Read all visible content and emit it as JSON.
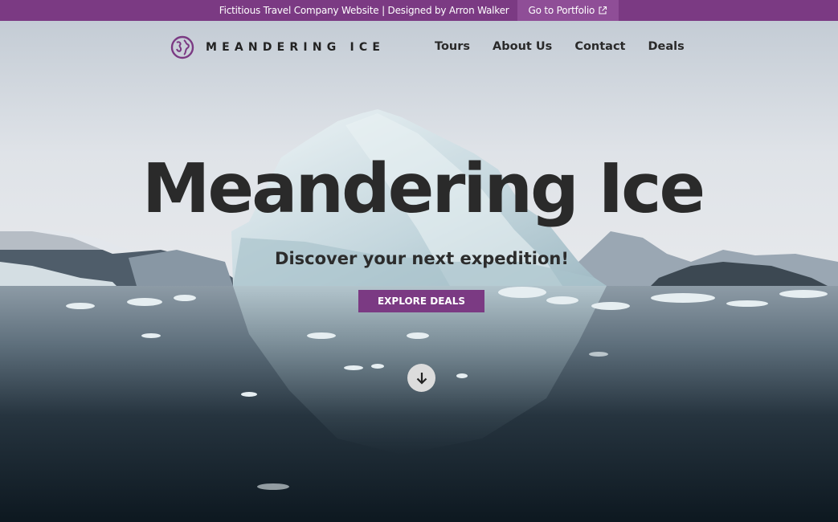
{
  "banner": {
    "text": "Fictitious Travel Company Website | Designed by Arron Walker",
    "portfolio_label": "Go to Portfolio"
  },
  "brand": {
    "name": "MEANDERING ICE",
    "accent_color": "#7b3a83"
  },
  "nav": {
    "items": [
      {
        "label": "Tours"
      },
      {
        "label": "About Us"
      },
      {
        "label": "Contact"
      },
      {
        "label": "Deals"
      }
    ]
  },
  "hero": {
    "title": "Meandering Ice",
    "subtitle": "Discover your next expedition!",
    "cta_label": "EXPLORE DEALS",
    "scroll_icon": "arrow-down-icon"
  },
  "icons": {
    "logo": "globe-icon",
    "external": "external-link-icon"
  }
}
